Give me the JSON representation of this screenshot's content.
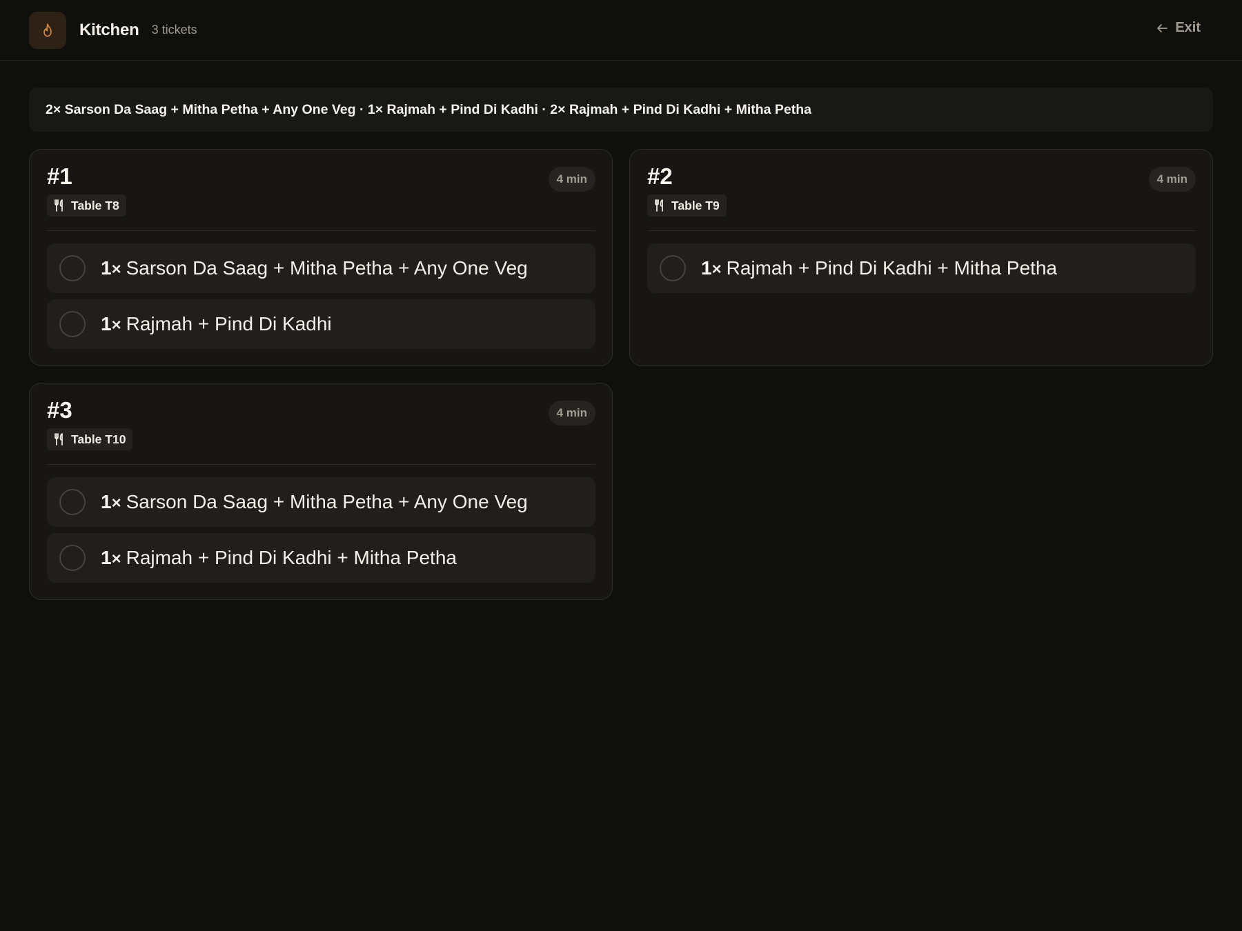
{
  "header": {
    "logo_icon": "flame-icon",
    "title": "Kitchen",
    "ticket_count": "3 tickets",
    "exit_label": "Exit",
    "exit_icon": "arrow-left-icon"
  },
  "summary": "2× Sarson Da Saag + Mitha Petha + Any One Veg · 1× Rajmah + Pind Di Kadhi · 2× Rajmah + Pind Di Kadhi + Mitha Petha",
  "tickets": [
    {
      "number": "#1",
      "time": "4 min",
      "table": "Table T8",
      "items": [
        {
          "qty": "1",
          "x": "×",
          "name": "Sarson Da Saag + Mitha Petha + Any One Veg"
        },
        {
          "qty": "1",
          "x": "×",
          "name": "Rajmah + Pind Di Kadhi"
        }
      ]
    },
    {
      "number": "#2",
      "time": "4 min",
      "table": "Table T9",
      "items": [
        {
          "qty": "1",
          "x": "×",
          "name": "Rajmah + Pind Di Kadhi + Mitha Petha"
        }
      ]
    },
    {
      "number": "#3",
      "time": "4 min",
      "table": "Table T10",
      "items": [
        {
          "qty": "1",
          "x": "×",
          "name": "Sarson Da Saag + Mitha Petha + Any One Veg"
        },
        {
          "qty": "1",
          "x": "×",
          "name": "Rajmah + Pind Di Kadhi + Mitha Petha"
        }
      ]
    }
  ],
  "colors": {
    "background": "#0f0f0c",
    "card": "#171614",
    "item": "#211f1c",
    "accent_flame": "#d9893f",
    "muted_text": "#a29c92"
  }
}
